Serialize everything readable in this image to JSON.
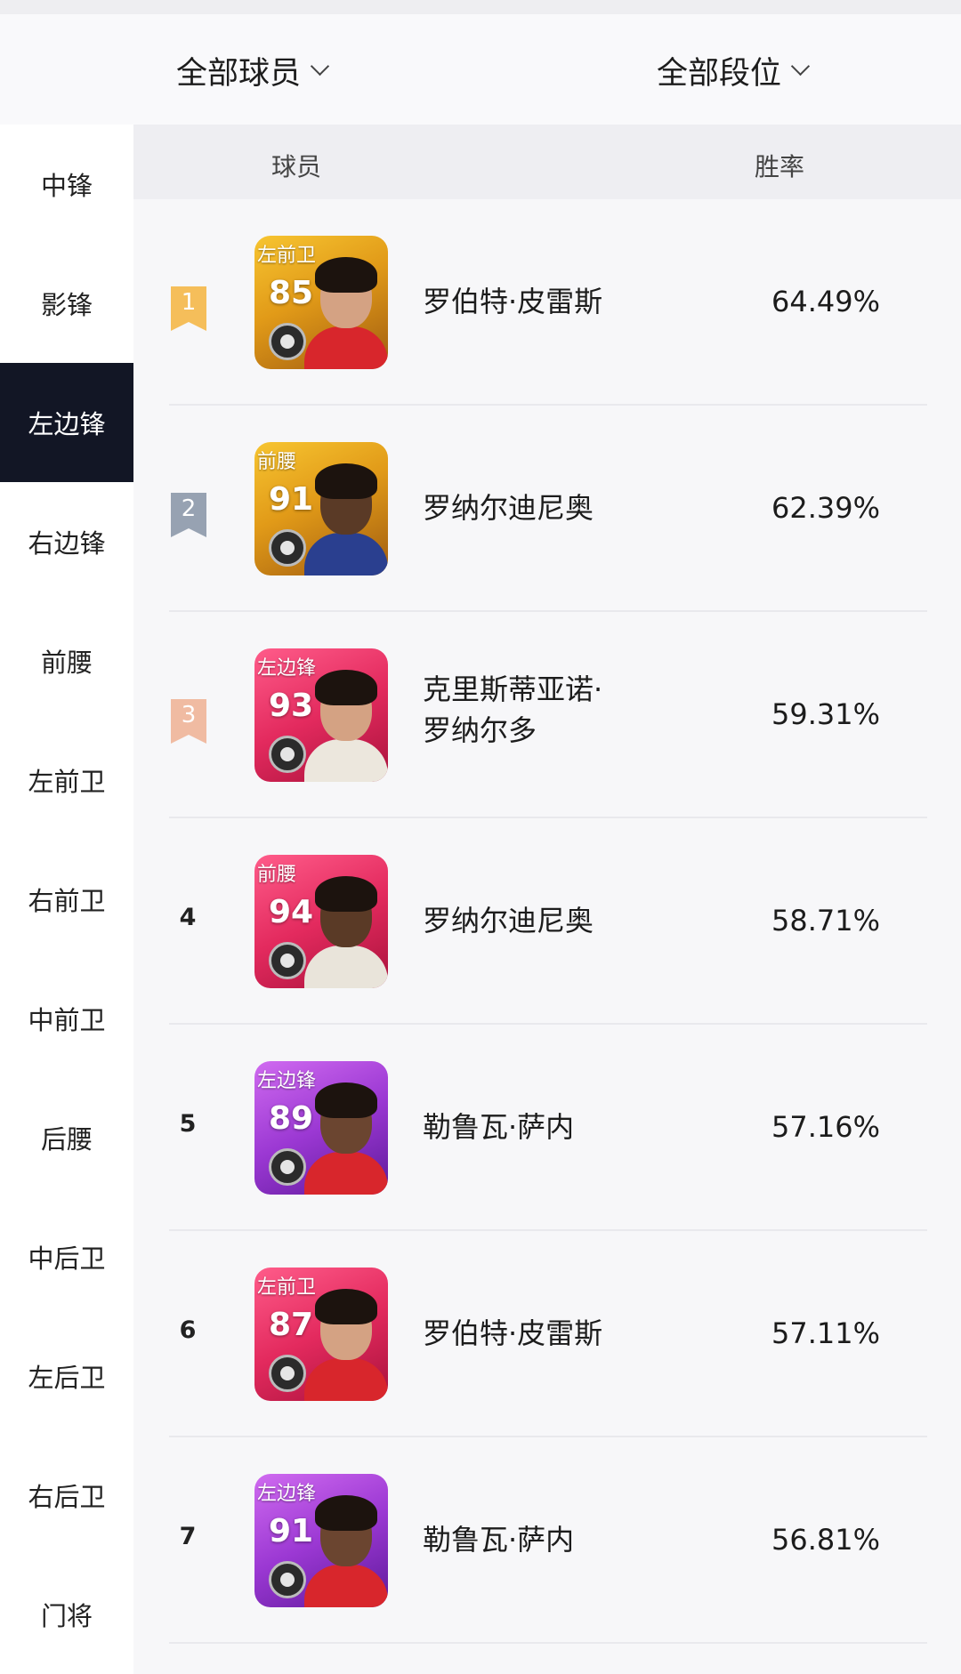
{
  "filters": {
    "players": "全部球员",
    "ranks": "全部段位"
  },
  "sidebar": {
    "items": [
      {
        "label": "中锋",
        "active": false
      },
      {
        "label": "影锋",
        "active": false
      },
      {
        "label": "左边锋",
        "active": true
      },
      {
        "label": "右边锋",
        "active": false
      },
      {
        "label": "前腰",
        "active": false
      },
      {
        "label": "左前卫",
        "active": false
      },
      {
        "label": "右前卫",
        "active": false
      },
      {
        "label": "中前卫",
        "active": false
      },
      {
        "label": "后腰",
        "active": false
      },
      {
        "label": "中后卫",
        "active": false
      },
      {
        "label": "左后卫",
        "active": false
      },
      {
        "label": "右后卫",
        "active": false
      },
      {
        "label": "门将",
        "active": false
      }
    ]
  },
  "table": {
    "col_player": "球员",
    "col_winrate": "胜率",
    "rows": [
      {
        "rank": "1",
        "badge": "gold",
        "position": "左前卫",
        "rating": "85",
        "card_color": "gold",
        "name_line1": "罗伯特·皮雷斯",
        "name_line2": "",
        "winrate": "64.49%",
        "jersey": "#d8262c",
        "skin": "#d4a283"
      },
      {
        "rank": "2",
        "badge": "silver",
        "position": "前腰",
        "rating": "91",
        "card_color": "gold",
        "name_line1": "罗纳尔迪尼奥",
        "name_line2": "",
        "winrate": "62.39%",
        "jersey": "#2a3f8f",
        "skin": "#5a3a26"
      },
      {
        "rank": "3",
        "badge": "bronze",
        "position": "左边锋",
        "rating": "93",
        "card_color": "pink",
        "name_line1": "克里斯蒂亚诺·",
        "name_line2": "罗纳尔多",
        "winrate": "59.31%",
        "jersey": "#ece7dd",
        "skin": "#d4a283"
      },
      {
        "rank": "4",
        "badge": "",
        "position": "前腰",
        "rating": "94",
        "card_color": "pink",
        "name_line1": "罗纳尔迪尼奥",
        "name_line2": "",
        "winrate": "58.71%",
        "jersey": "#e9e4da",
        "skin": "#5a3a26"
      },
      {
        "rank": "5",
        "badge": "",
        "position": "左边锋",
        "rating": "89",
        "card_color": "purple",
        "name_line1": "勒鲁瓦·萨内",
        "name_line2": "",
        "winrate": "57.16%",
        "jersey": "#d8262c",
        "skin": "#6b4530"
      },
      {
        "rank": "6",
        "badge": "",
        "position": "左前卫",
        "rating": "87",
        "card_color": "pink",
        "name_line1": "罗伯特·皮雷斯",
        "name_line2": "",
        "winrate": "57.11%",
        "jersey": "#d8262c",
        "skin": "#d4a283"
      },
      {
        "rank": "7",
        "badge": "",
        "position": "左边锋",
        "rating": "91",
        "card_color": "purple",
        "name_line1": "勒鲁瓦·萨内",
        "name_line2": "",
        "winrate": "56.81%",
        "jersey": "#d8262c",
        "skin": "#6b4530"
      }
    ]
  },
  "colors": {
    "active_sidebar": "#121625",
    "rank_gold": "#f5be5a",
    "rank_silver": "#97a2b2",
    "rank_bronze": "#f0bba2"
  }
}
